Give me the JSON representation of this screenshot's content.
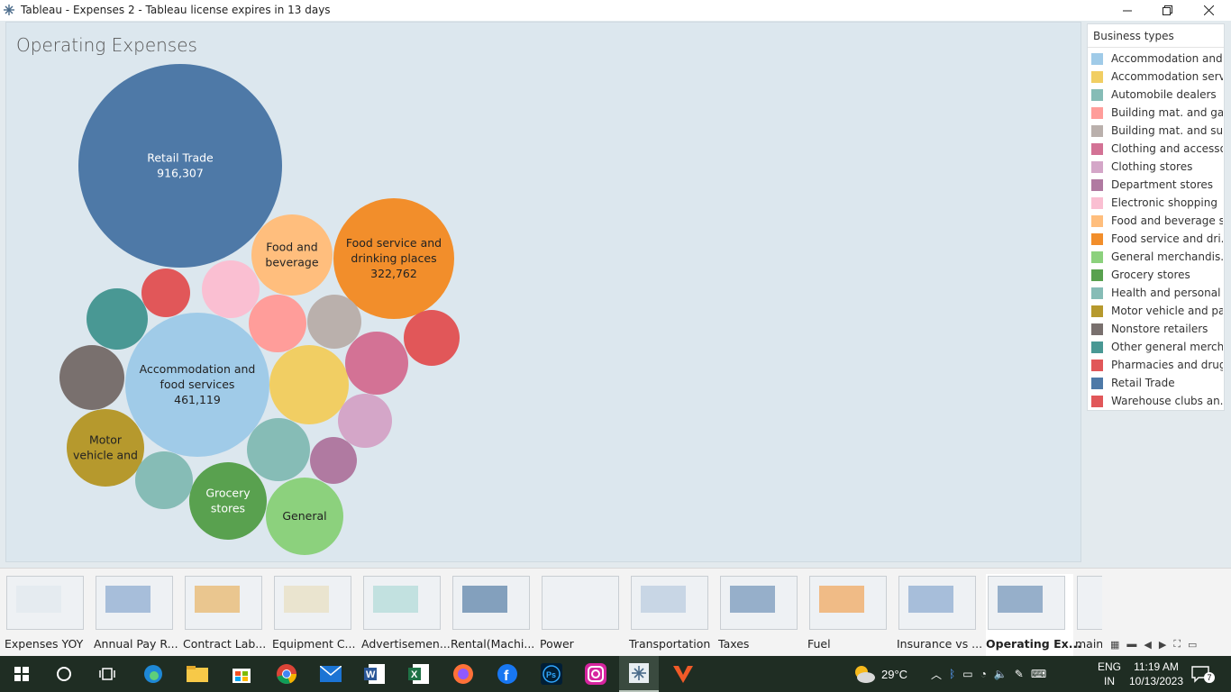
{
  "window": {
    "title": "Tableau - Expenses 2 - Tableau license expires in 13 days"
  },
  "viz": {
    "title": "Operating Expenses"
  },
  "bubbles": [
    {
      "name": "Retail Trade",
      "value": "916,307",
      "label": [
        "Retail Trade",
        "916,307"
      ],
      "color": "#4e79a7",
      "text_color": "#ffffff"
    },
    {
      "name": "Accommodation and food services",
      "value": "461,119",
      "label": [
        "Accommodation and",
        "food services",
        "461,119"
      ],
      "color": "#a0cbe8",
      "text_color": "#222222"
    },
    {
      "name": "Food service and drinking places",
      "value": "322,762",
      "label": [
        "Food service and",
        "drinking places",
        "322,762"
      ],
      "color": "#f28e2b",
      "text_color": "#222222"
    },
    {
      "name": "Food and beverage",
      "label": [
        "Food and",
        "beverage"
      ],
      "color": "#ffbe7d",
      "text_color": "#222222"
    },
    {
      "name": "Motor vehicle and",
      "label": [
        "Motor",
        "vehicle and"
      ],
      "color": "#b6992d",
      "text_color": "#222222"
    },
    {
      "name": "Grocery stores",
      "label": [
        "Grocery",
        "stores"
      ],
      "color": "#59a14f",
      "text_color": "#ffffff"
    },
    {
      "name": "General",
      "label": [
        "General"
      ],
      "color": "#8cd17d",
      "text_color": "#222222"
    },
    {
      "name": "Accommodation services",
      "label": [],
      "color": "#f1ce63",
      "text_color": "#222222"
    },
    {
      "name": "Building mat. and garden",
      "label": [],
      "color": "#ff9d9a",
      "text_color": "#222222"
    },
    {
      "name": "Building mat. and supplies",
      "label": [],
      "color": "#bab0ac",
      "text_color": "#222222"
    },
    {
      "name": "Clothing and accessories",
      "label": [],
      "color": "#d37295",
      "text_color": "#222222"
    },
    {
      "name": "Clothing stores",
      "label": [],
      "color": "#d4a6c8",
      "text_color": "#222222"
    },
    {
      "name": "Department stores",
      "label": [],
      "color": "#b07aa1",
      "text_color": "#222222"
    },
    {
      "name": "Electronic shopping",
      "label": [],
      "color": "#fabfd2",
      "text_color": "#222222"
    },
    {
      "name": "Health and personal",
      "label": [],
      "color": "#86bcb6",
      "text_color": "#222222"
    },
    {
      "name": "Nonstore retailers",
      "label": [],
      "color": "#79706e",
      "text_color": "#222222"
    },
    {
      "name": "Other general merchandise",
      "label": [],
      "color": "#499894",
      "text_color": "#222222"
    },
    {
      "name": "Pharmacies and drug",
      "label": [],
      "color": "#e15759",
      "text_color": "#222222"
    },
    {
      "name": "Warehouse clubs",
      "label": [],
      "color": "#e15759",
      "text_color": "#222222"
    },
    {
      "name": "Automobile dealers",
      "label": [],
      "color": "#86bcb6",
      "text_color": "#222222"
    }
  ],
  "legend": {
    "title": "Business types",
    "items": [
      {
        "label": "Accommodation and ..",
        "color": "#a0cbe8"
      },
      {
        "label": "Accommodation serv..",
        "color": "#f1ce63"
      },
      {
        "label": "Automobile dealers",
        "color": "#86bcb6"
      },
      {
        "label": "Building mat. and ga..",
        "color": "#ff9d9a"
      },
      {
        "label": "Building mat. and su..",
        "color": "#bab0ac"
      },
      {
        "label": "Clothing and accesso..",
        "color": "#d37295"
      },
      {
        "label": "Clothing stores",
        "color": "#d4a6c8"
      },
      {
        "label": "Department stores",
        "color": "#b07aa1"
      },
      {
        "label": "Electronic shopping",
        "color": "#fabfd2"
      },
      {
        "label": "Food and beverage s..",
        "color": "#ffbe7d"
      },
      {
        "label": "Food service and dri..",
        "color": "#f28e2b"
      },
      {
        "label": "General merchandis..",
        "color": "#8cd17d"
      },
      {
        "label": "Grocery stores",
        "color": "#59a14f"
      },
      {
        "label": "Health and personal ..",
        "color": "#86bcb6"
      },
      {
        "label": "Motor vehicle and pa..",
        "color": "#b6992d"
      },
      {
        "label": "Nonstore retailers",
        "color": "#79706e"
      },
      {
        "label": "Other general merch..",
        "color": "#499894"
      },
      {
        "label": "Pharmacies and drug..",
        "color": "#e15759"
      },
      {
        "label": "Retail Trade",
        "color": "#4e79a7"
      },
      {
        "label": "Warehouse clubs an..",
        "color": "#e15759"
      }
    ]
  },
  "sheet_tabs": [
    {
      "label": "Expenses YOY",
      "active": false
    },
    {
      "label": "Annual Pay R...",
      "active": false
    },
    {
      "label": "Contract Lab...",
      "active": false
    },
    {
      "label": "Equipment C...",
      "active": false
    },
    {
      "label": "Advertisemen...",
      "active": false
    },
    {
      "label": "Rental(Machi...",
      "active": false
    },
    {
      "label": "Power",
      "active": false
    },
    {
      "label": "Transportation",
      "active": false
    },
    {
      "label": "Taxes",
      "active": false
    },
    {
      "label": "Fuel",
      "active": false
    },
    {
      "label": "Insurance vs ...",
      "active": false
    },
    {
      "label": "Operating Ex...",
      "active": true
    },
    {
      "label": "main",
      "active": false
    }
  ],
  "taskbar": {
    "weather": "29°C",
    "lang_top": "ENG",
    "lang_bottom": "IN",
    "time": "11:19 AM",
    "date": "10/13/2023",
    "notifications": "7"
  }
}
